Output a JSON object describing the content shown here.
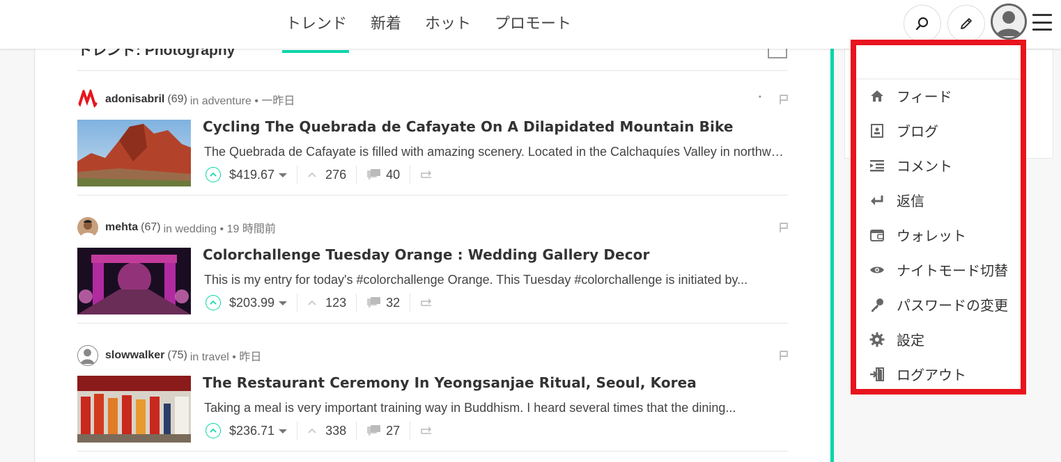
{
  "nav": {
    "items": [
      "トレンド",
      "新着",
      "ホット",
      "プロモート"
    ]
  },
  "section": {
    "title": "トレンド: Photography"
  },
  "posts": [
    {
      "author": "adonisabril",
      "reputation": "(69)",
      "category": "in adventure • 一昨日",
      "title": "Cycling The Quebrada de Cafayate On A Dilapidated Mountain Bike",
      "summary": "The Quebrada de Cafayate is filled with amazing scenery. Located in the Calchaquíes Valley in northwestern Argentina...",
      "payout": "$419.67",
      "votes": "276",
      "comments": "40"
    },
    {
      "author": "mehta",
      "reputation": "(67)",
      "category": "in wedding • 19 時間前",
      "title": "Colorchallenge Tuesday Orange : Wedding Gallery Decor",
      "summary": "This is my entry for today's #colorchallenge Orange. This Tuesday #colorchallenge is initiated by...",
      "payout": "$203.99",
      "votes": "123",
      "comments": "32"
    },
    {
      "author": "slowwalker",
      "reputation": "(75)",
      "category": "in travel • 昨日",
      "title": "The Restaurant Ceremony In Yeongsanjae Ritual, Seoul, Korea",
      "summary": "Taking a meal is very important training way in Buddhism. I heard several times that the dining...",
      "payout": "$236.71",
      "votes": "338",
      "comments": "27"
    }
  ],
  "menu": {
    "items": [
      {
        "label": "フィード",
        "icon": "home-icon"
      },
      {
        "label": "ブログ",
        "icon": "blog-icon"
      },
      {
        "label": "コメント",
        "icon": "comment-icon"
      },
      {
        "label": "返信",
        "icon": "reply-icon"
      },
      {
        "label": "ウォレット",
        "icon": "wallet-icon"
      },
      {
        "label": "ナイトモード切替",
        "icon": "eye-icon"
      },
      {
        "label": "パスワードの変更",
        "icon": "key-icon"
      },
      {
        "label": "設定",
        "icon": "gear-icon"
      },
      {
        "label": "ログアウト",
        "icon": "logout-icon"
      }
    ]
  },
  "colors": {
    "accent": "#06d6a9",
    "highlight": "#e8141e",
    "text": "#333333"
  }
}
